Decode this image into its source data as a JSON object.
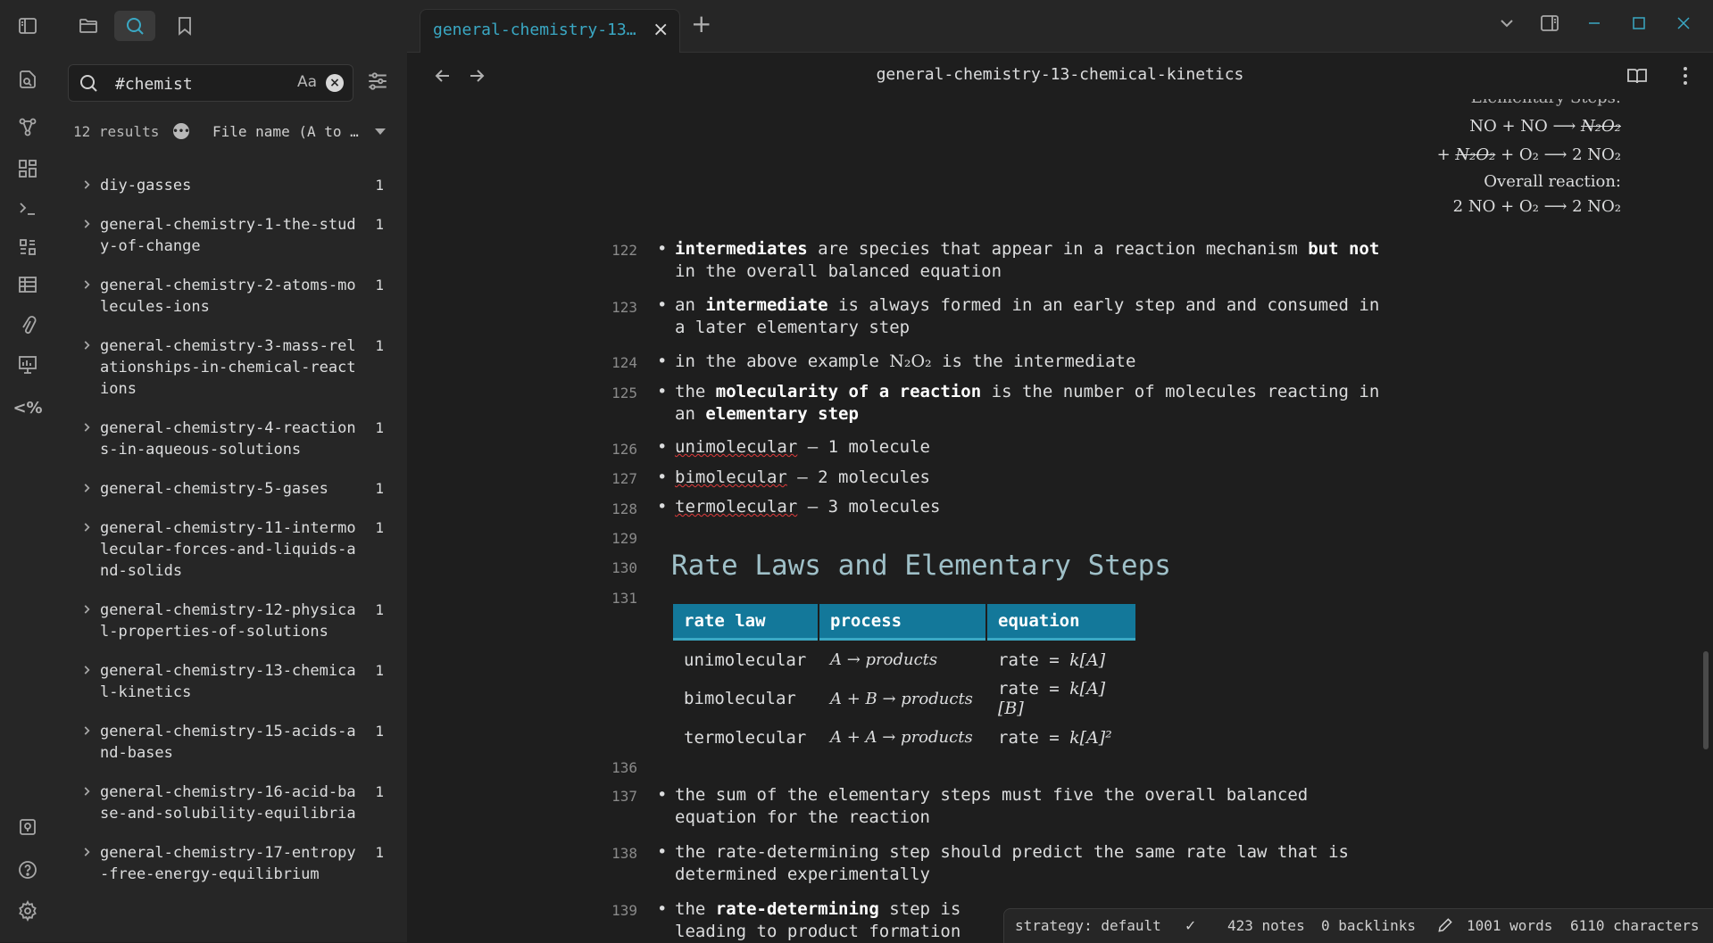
{
  "ribbon": {
    "icons": [
      "open-quick-switcher-icon",
      "graph-view-icon",
      "canvas-icon",
      "command-palette-icon",
      "daily-notes-icon",
      "table-icon",
      "paperclip-icon",
      "slides-icon",
      "percent-code-icon",
      "vault-switch-icon",
      "help-icon",
      "settings-icon"
    ],
    "percent_label": "<%"
  },
  "sidebar": {
    "toolbar_icons": [
      "sidebar-toggle-icon",
      "folder-icon",
      "search-icon",
      "bookmark-icon"
    ],
    "search": {
      "value": "#chemist",
      "case_label": "Aa"
    },
    "results_count": "12 results",
    "sort_label": "File name (A to …",
    "results": [
      {
        "name": "diy-gasses",
        "count": "1"
      },
      {
        "name": "general-chemistry-1-the-study-of-change",
        "count": "1"
      },
      {
        "name": "general-chemistry-2-atoms-molecules-ions",
        "count": "1"
      },
      {
        "name": "general-chemistry-3-mass-relationships-in-chemical-reactions",
        "count": "1"
      },
      {
        "name": "general-chemistry-4-reactions-in-aqueous-solutions",
        "count": "1"
      },
      {
        "name": "general-chemistry-5-gases",
        "count": "1"
      },
      {
        "name": "general-chemistry-11-intermolecular-forces-and-liquids-and-solids",
        "count": "1"
      },
      {
        "name": "general-chemistry-12-physical-properties-of-solutions",
        "count": "1"
      },
      {
        "name": "general-chemistry-13-chemical-kinetics",
        "count": "1"
      },
      {
        "name": "general-chemistry-15-acids-and-bases",
        "count": "1"
      },
      {
        "name": "general-chemistry-16-acid-base-and-solubility-equilibria",
        "count": "1"
      },
      {
        "name": "general-chemistry-17-entropy-free-energy-equilibrium",
        "count": "1"
      }
    ]
  },
  "tabs": {
    "active_title": "general-chemistry-13…",
    "close": "×",
    "new": "+"
  },
  "doc": {
    "title": "general-chemistry-13-chemical-kinetics",
    "math": {
      "partial_header": "Elementary Steps:",
      "step1_lhs": "NO + NO ⟶",
      "step1_rhs": "N₂O₂",
      "step2_lhs": "+",
      "step2_mid": "N₂O₂",
      "step2_rhs": "+ O₂ ⟶ 2 NO₂",
      "overall_label": "Overall reaction:",
      "overall": "2 NO + O₂ ⟶ 2 NO₂"
    },
    "lines": {
      "l122": "122",
      "l123": "123",
      "l124": "124",
      "l125": "125",
      "l126": "126",
      "l127": "127",
      "l128": "128",
      "l129": "129",
      "l130": "130",
      "l131": "131",
      "l136": "136",
      "l137": "137",
      "l138": "138",
      "l139": "139"
    },
    "b122": {
      "pre": "intermediates",
      "mid": " are species that appear in a reaction mechanism ",
      "bold2": "but not",
      "post": " in the overall balanced equation"
    },
    "b123": {
      "pre": "an ",
      "bold": "intermediate",
      "post": " is always formed in an early step and and consumed in a later elementary step"
    },
    "b124": {
      "pre": "in the above example ",
      "formula": "N₂O₂",
      "post": " is the intermediate"
    },
    "b125": {
      "pre": "the ",
      "bold": "molecularity of a reaction",
      "mid": " is the number of molecules reacting in an ",
      "bold2": "elementary step"
    },
    "b126": {
      "word": "unimolecular",
      "post": " – 1 molecule"
    },
    "b127": {
      "word": "bimolecular",
      "post": " – 2 molecules"
    },
    "b128": {
      "word": "termolecular",
      "post": " – 3 molecules"
    },
    "heading": "Rate Laws and Elementary Steps",
    "table": {
      "headers": [
        "rate law",
        "process",
        "equation"
      ],
      "rows": [
        {
          "law": "unimolecular",
          "process": "A → products",
          "eq_pre": "rate = ",
          "eq_math": "k[A]"
        },
        {
          "law": "bimolecular",
          "process": "A + B → products",
          "eq_pre": "rate = ",
          "eq_math": "k[A][B]"
        },
        {
          "law": "termolecular",
          "process": "A + A → products",
          "eq_pre": "rate = ",
          "eq_math": "k[A]²"
        }
      ]
    },
    "b137": "the sum of the elementary steps must five the overall balanced equation for the reaction",
    "b138": "the rate-determining step should predict the same rate law that is determined experimentally",
    "b139": {
      "pre": "the ",
      "bold": "rate-determining",
      "post": " step is",
      "line2": "leading to product formation"
    }
  },
  "status": {
    "strategy": "strategy: default",
    "notes": "423 notes",
    "backlinks": "0 backlinks",
    "words": "1001 words",
    "chars": "6110 characters"
  },
  "colors": {
    "accent": "#3aa8c4",
    "table_header": "#13789a",
    "heading": "#9fc0c8",
    "background": "#1e1e1e"
  }
}
